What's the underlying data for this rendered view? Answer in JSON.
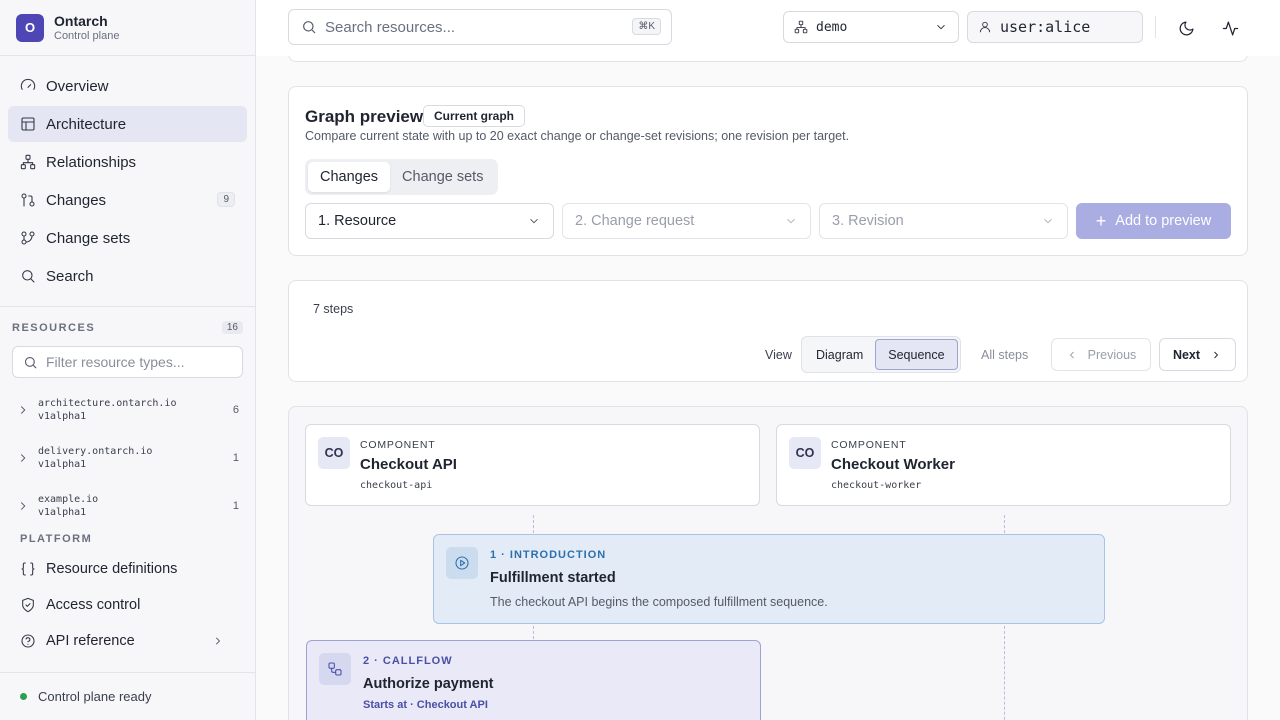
{
  "brand": {
    "logo_letter": "O",
    "name": "Ontarch",
    "subtitle": "Control plane"
  },
  "nav": {
    "items": [
      {
        "label": "Overview",
        "icon": "gauge-icon"
      },
      {
        "label": "Architecture",
        "icon": "layout-icon",
        "active": true
      },
      {
        "label": "Relationships",
        "icon": "network-icon"
      },
      {
        "label": "Changes",
        "icon": "git-compare-icon",
        "badge": "9"
      },
      {
        "label": "Change sets",
        "icon": "git-branch-icon"
      },
      {
        "label": "Search",
        "icon": "search-icon"
      }
    ]
  },
  "resources": {
    "title": "RESOURCES",
    "count": "16",
    "filter_placeholder": "Filter resource types...",
    "groups": [
      {
        "name": "architecture.ontarch.io",
        "version": "v1alpha1",
        "count": "6"
      },
      {
        "name": "delivery.ontarch.io",
        "version": "v1alpha1",
        "count": "1"
      },
      {
        "name": "example.io",
        "version": "v1alpha1",
        "count": "1"
      }
    ]
  },
  "platform": {
    "title": "PLATFORM",
    "items": [
      {
        "label": "Resource definitions",
        "icon": "braces-icon"
      },
      {
        "label": "Access control",
        "icon": "shield-icon"
      },
      {
        "label": "API reference",
        "icon": "help-circle-icon"
      }
    ]
  },
  "status": {
    "text": "Control plane ready",
    "color": "#2e9e52"
  },
  "topbar": {
    "search_placeholder": "Search resources...",
    "search_shortcut": "⌘K",
    "namespace": "demo",
    "user": "user:alice"
  },
  "graph_preview": {
    "title": "Graph preview",
    "pill": "Current graph",
    "description": "Compare current state with up to 20 exact change or change-set revisions; one revision per target.",
    "tabs": [
      "Changes",
      "Change sets"
    ],
    "selects": [
      "1. Resource",
      "2. Change request",
      "3. Revision"
    ],
    "add_button": "Add to preview"
  },
  "stepper": {
    "steps_label": "7 steps",
    "view_label": "View",
    "view_options": [
      "Diagram",
      "Sequence"
    ],
    "all_steps": "All steps",
    "previous": "Previous",
    "next": "Next"
  },
  "sequence": {
    "components": [
      {
        "abbr": "CO",
        "kind": "COMPONENT",
        "name": "Checkout API",
        "slug": "checkout-api"
      },
      {
        "abbr": "CO",
        "kind": "COMPONENT",
        "name": "Checkout Worker",
        "slug": "checkout-worker"
      }
    ],
    "steps": [
      {
        "meta": "1 · INTRODUCTION",
        "title": "Fulfillment started",
        "description": "The checkout API begins the composed fulfillment sequence."
      },
      {
        "meta": "2 · CALLFLOW",
        "title": "Authorize payment",
        "starts": "Starts at · Checkout API"
      }
    ]
  },
  "colors": {
    "accent": "#4f46b5",
    "primary_disabled": "#a9ade2",
    "intro": "#2e6fae",
    "callflow": "#4a4fa8"
  }
}
